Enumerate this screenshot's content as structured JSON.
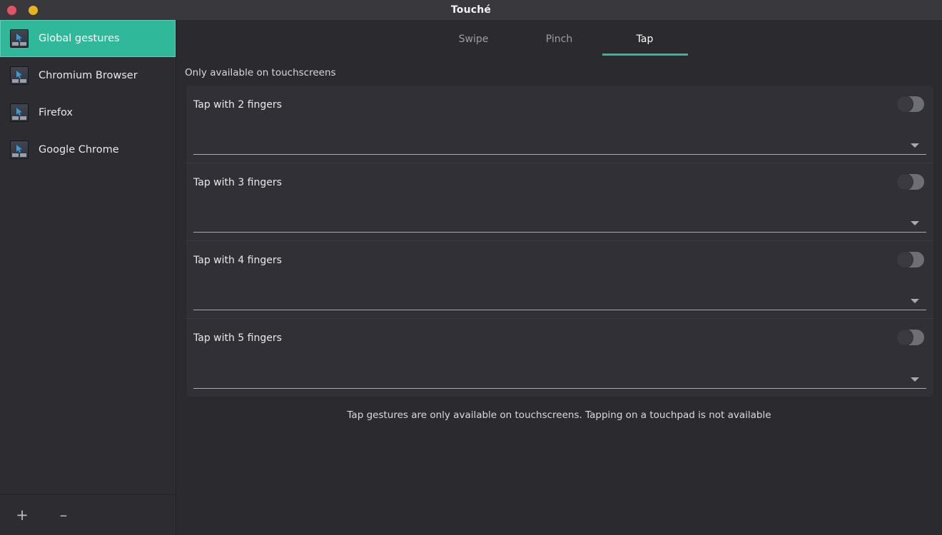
{
  "window": {
    "title": "Touché",
    "controls": [
      {
        "name": "close",
        "icon": "close-dot",
        "color": "#e05561"
      },
      {
        "name": "minimize",
        "icon": "minimize-dot",
        "color": "#e6b422"
      }
    ]
  },
  "sidebar": {
    "items": [
      {
        "label": "Global gestures",
        "icon": "touchpad-cursor-icon",
        "selected": true
      },
      {
        "label": "Chromium Browser",
        "icon": "touchpad-cursor-icon",
        "selected": false
      },
      {
        "label": "Firefox",
        "icon": "touchpad-cursor-icon",
        "selected": false
      },
      {
        "label": "Google Chrome",
        "icon": "touchpad-cursor-icon",
        "selected": false
      }
    ],
    "footer": {
      "add_label": "+",
      "remove_label": "–"
    }
  },
  "tabs": [
    {
      "label": "Swipe",
      "active": false
    },
    {
      "label": "Pinch",
      "active": false
    },
    {
      "label": "Tap",
      "active": true
    }
  ],
  "main": {
    "availability_note": "Only available on touchscreens",
    "footer_note": "Tap gestures are only available on touchscreens. Tapping on a touchpad is not available",
    "gestures": [
      {
        "title": "Tap with 2 fingers",
        "enabled": false,
        "action_value": ""
      },
      {
        "title": "Tap with 3 fingers",
        "enabled": false,
        "action_value": ""
      },
      {
        "title": "Tap with 4 fingers",
        "enabled": false,
        "action_value": ""
      },
      {
        "title": "Tap with 5 fingers",
        "enabled": false,
        "action_value": ""
      }
    ]
  },
  "colors": {
    "accent": "#2fb99a",
    "window_bg": "#2b2b2f",
    "titlebar_bg": "#38383d",
    "sidebar_bg": "#2d2d31",
    "card_bg": "#303036"
  }
}
